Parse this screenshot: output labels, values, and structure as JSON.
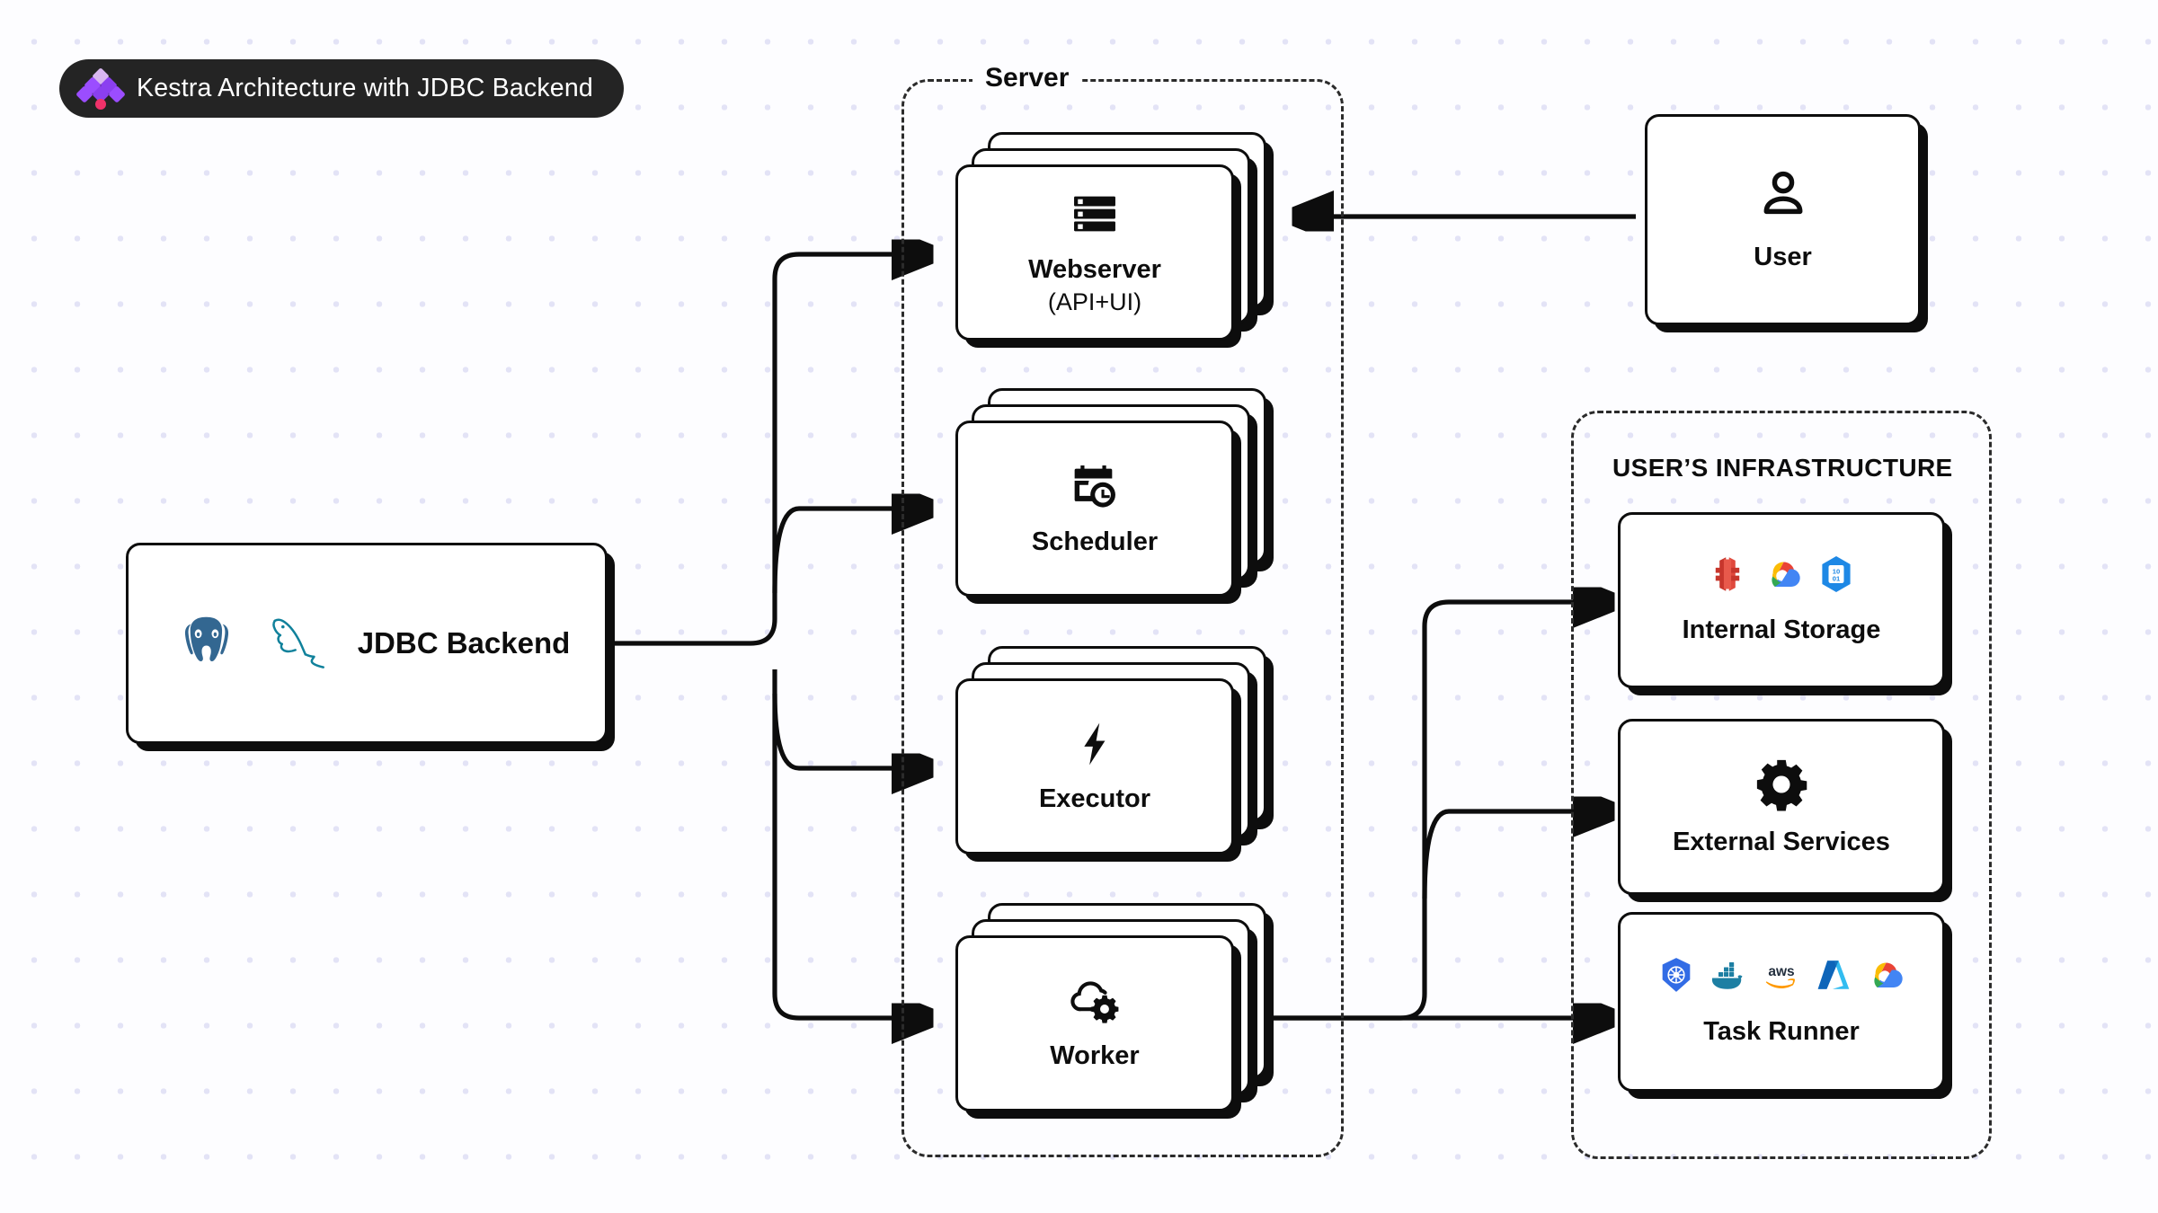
{
  "title": {
    "text": "Kestra Architecture with JDBC Backend",
    "badge_color": "#242424",
    "text_color": "#ffffff",
    "logo_name": "kestra-logo"
  },
  "canvas": {
    "background": "#fdfdff",
    "dot_color": "#e3e3f6"
  },
  "groups": [
    {
      "id": "server",
      "label": "Server"
    },
    {
      "id": "infrastructure",
      "label": "USER’S INFRASTRUCTURE"
    }
  ],
  "nodes": {
    "jdbc_backend": {
      "label": "JDBC Backend",
      "icons": [
        "postgresql-logo",
        "mysql-logo"
      ]
    },
    "webserver": {
      "label": "Webserver",
      "sublabel": "(API+UI)",
      "icon": "server-rack-icon",
      "stacked": true
    },
    "scheduler": {
      "label": "Scheduler",
      "icon": "calendar-clock-icon",
      "stacked": true
    },
    "executor": {
      "label": "Executor",
      "icon": "lightning-bolt-icon",
      "stacked": true
    },
    "worker": {
      "label": "Worker",
      "icon": "cloud-gear-icon",
      "stacked": true
    },
    "user": {
      "label": "User",
      "icon": "person-icon"
    },
    "internal_storage": {
      "label": "Internal Storage",
      "icons": [
        "aws-s3-logo",
        "google-cloud-storage-logo",
        "azure-blob-storage-logo"
      ]
    },
    "external_services": {
      "label": "External Services",
      "icon": "gear-icon"
    },
    "task_runner": {
      "label": "Task Runner",
      "icons": [
        "kubernetes-logo",
        "docker-logo",
        "aws-logo",
        "azure-logo",
        "google-cloud-logo"
      ]
    }
  },
  "connections": [
    {
      "from": "jdbc_backend",
      "to": "webserver",
      "direction": "forward"
    },
    {
      "from": "jdbc_backend",
      "to": "scheduler",
      "direction": "forward"
    },
    {
      "from": "jdbc_backend",
      "to": "executor",
      "direction": "forward"
    },
    {
      "from": "jdbc_backend",
      "to": "worker",
      "direction": "forward"
    },
    {
      "from": "user",
      "to": "webserver",
      "direction": "forward"
    },
    {
      "from": "worker",
      "to": "internal_storage",
      "direction": "forward"
    },
    {
      "from": "worker",
      "to": "external_services",
      "direction": "forward"
    },
    {
      "from": "worker",
      "to": "task_runner",
      "direction": "forward"
    }
  ]
}
